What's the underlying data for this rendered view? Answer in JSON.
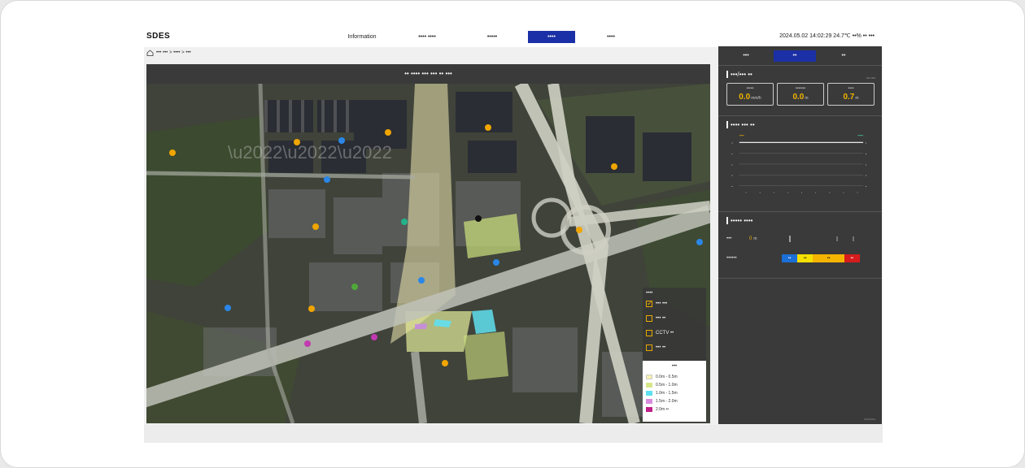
{
  "app": {
    "logo": "SDES"
  },
  "nav": {
    "items": [
      "Information",
      "•••• ••••",
      "•••••",
      "••••",
      "••••"
    ]
  },
  "clock": {
    "text": "2024.05.02 14:02:29 24.7℃ ••% •• •••"
  },
  "breadcrumb": {
    "text": "••• ••• > •••• > •••"
  },
  "map": {
    "title": "•• •••• ••• ••• •• •••"
  },
  "legend": {
    "title": "••••",
    "items": [
      {
        "label": "••• •••",
        "checked": true
      },
      {
        "label": "••• ••",
        "checked": false
      },
      {
        "label": "CCTV ••",
        "checked": false
      },
      {
        "label": "••• ••",
        "checked": false
      }
    ]
  },
  "depth_legend": {
    "title": "•••",
    "items": [
      {
        "label": "0.0m - 0.5m",
        "color": "#f5f0b0"
      },
      {
        "label": "0.5m - 1.0m",
        "color": "#d8e68a"
      },
      {
        "label": "1.0m - 1.5m",
        "color": "#5fe0f0"
      },
      {
        "label": "1.5m - 2.0m",
        "color": "#d98be0"
      },
      {
        "label": "2.0m ••",
        "color": "#c0208a"
      }
    ]
  },
  "side": {
    "tabs": [
      "•••",
      "••",
      "••"
    ],
    "active_tab": 1,
    "rain_section": {
      "title": "•••/••• ••",
      "note": "••• ••••",
      "cards": [
        {
          "label": "•••••",
          "value": "0.0",
          "unit": "mm/h"
        },
        {
          "label": "•••••••",
          "value": "0.0",
          "unit": "m"
        },
        {
          "label": "••••",
          "value": "0.7",
          "unit": "m"
        }
      ]
    },
    "trend_section": {
      "title": "•••• ••• ••"
    },
    "stage_section": {
      "title": "••••• ••••",
      "rows": [
        {
          "label": "•••",
          "value": "0",
          "unit": "m"
        },
        {
          "label": "••••••"
        }
      ],
      "scale": [
        {
          "label": "••",
          "color": "#1c6fd6"
        },
        {
          "label": "••",
          "color": "#f5e000"
        },
        {
          "label": "••",
          "color": "#f5b400"
        },
        {
          "label": "••",
          "color": "#d61c1c"
        }
      ]
    },
    "footer": "••••••••••"
  }
}
